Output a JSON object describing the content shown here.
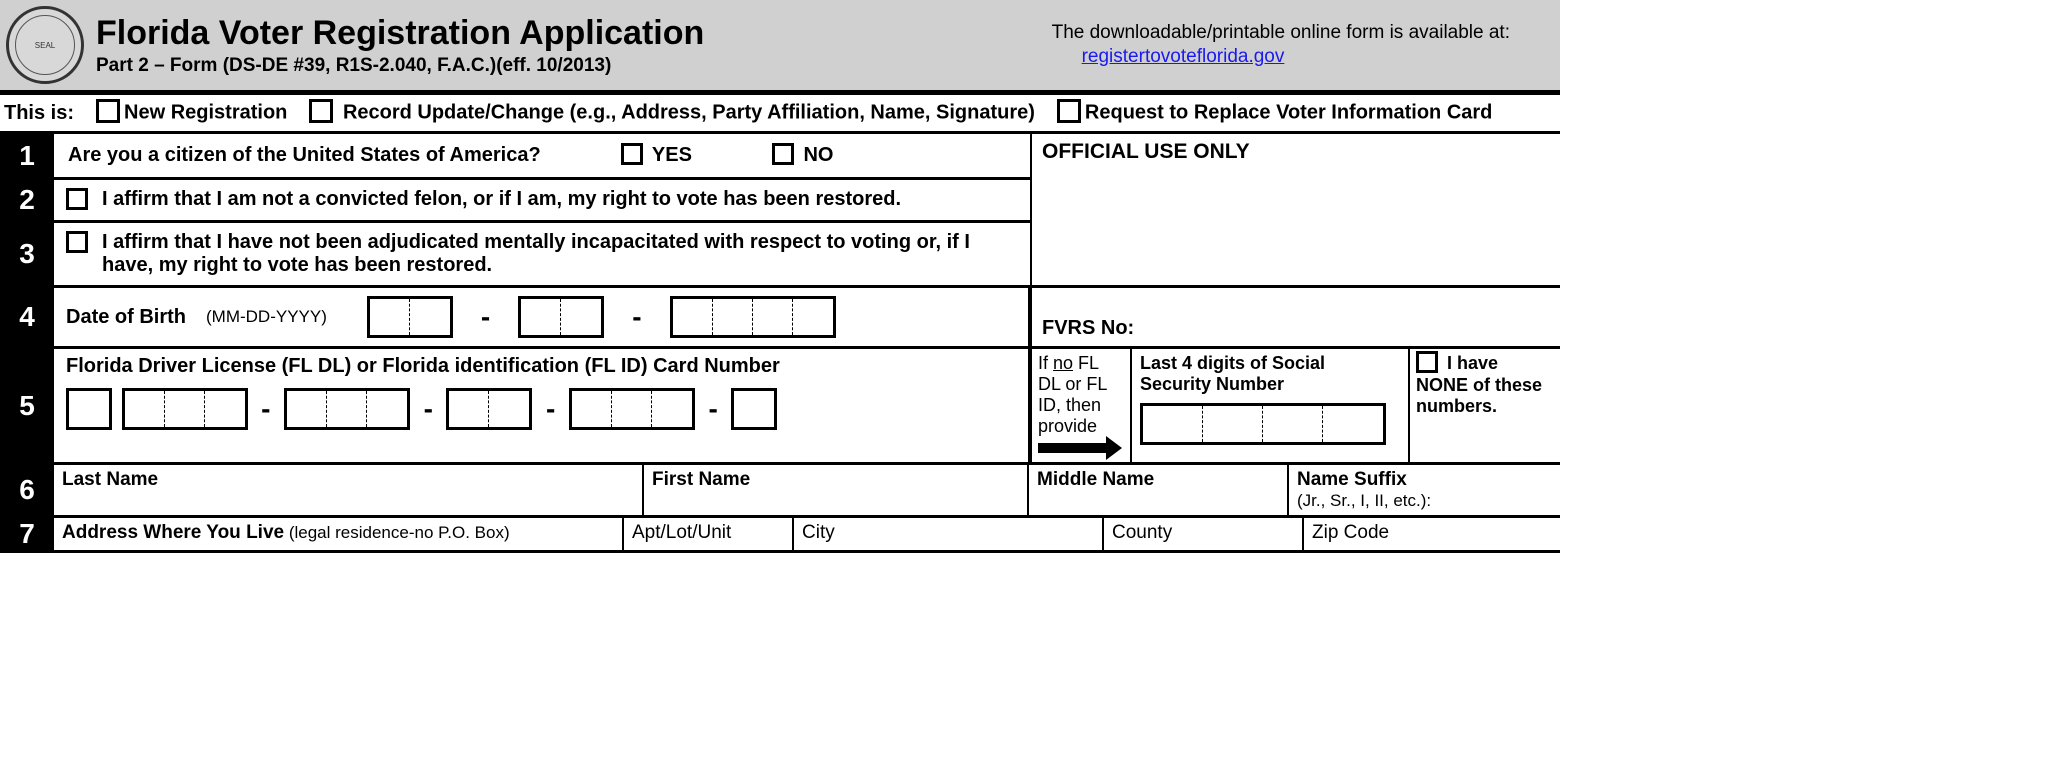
{
  "header": {
    "title": "Florida Voter Registration Application",
    "subtitle": "Part 2 – Form  (DS-DE #39, R1S-2.040, F.A.C.)(eff. 10/2013)",
    "download_text": "The downloadable/printable online form is available at:",
    "download_link": "registertovoteflorida.gov"
  },
  "thisis": {
    "label": "This is:",
    "opt1": "New Registration",
    "opt2": "Record Update/Change (e.g., Address, Party Affiliation, Name, Signature)",
    "opt3": "Request to Replace Voter Information Card"
  },
  "rows": {
    "r1": {
      "num": "1",
      "q": "Are you a citizen of the United States of America?",
      "yes": "YES",
      "no": "NO"
    },
    "r2": {
      "num": "2",
      "text": "I affirm that I am not a convicted felon, or if I am, my right to vote has been restored."
    },
    "r3": {
      "num": "3",
      "text": "I affirm that I have not been adjudicated mentally incapacitated with respect to voting or, if I have, my right to vote has been restored."
    },
    "r4": {
      "num": "4",
      "label": "Date of Birth",
      "fmt": "(MM-DD-YYYY)"
    },
    "r5": {
      "num": "5",
      "label": "Florida Driver License (FL DL) or Florida identification (FL ID) Card Number",
      "ifno_pre": "If ",
      "ifno_u": "no",
      "ifno_post": " FL DL or FL ID, then provide",
      "ssn": "Last 4 digits of Social Security Number",
      "none": "I have NONE of these numbers."
    },
    "r6": {
      "num": "6",
      "last": "Last Name",
      "first": "First Name",
      "middle": "Middle Name",
      "suffix": "Name Suffix",
      "suffix_sub": "(Jr., Sr., I, II, etc.):"
    },
    "r7": {
      "num": "7",
      "addr": "Address Where You Live",
      "addr_sub": " (legal residence-no P.O. Box)",
      "apt": "Apt/Lot/Unit",
      "city": "City",
      "county": "County",
      "zip": "Zip Code"
    }
  },
  "official": {
    "label": "OFFICIAL USE ONLY",
    "fvrs": "FVRS No:"
  }
}
